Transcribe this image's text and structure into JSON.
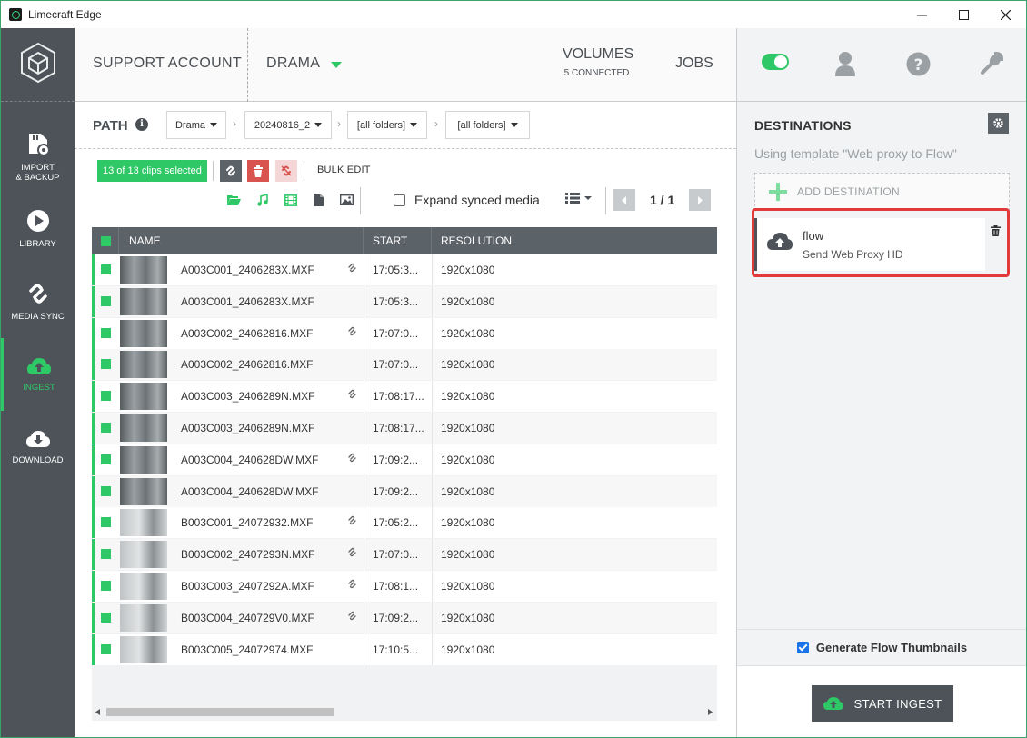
{
  "window": {
    "title": "Limecraft Edge",
    "controls": [
      "—",
      "☐",
      "✕"
    ]
  },
  "nav": {
    "items": [
      {
        "label_1": "IMPORT",
        "label_2": "& BACKUP",
        "icon": "sd-card-icon"
      },
      {
        "label": "LIBRARY",
        "icon": "play-icon"
      },
      {
        "label": "MEDIA SYNC",
        "icon": "link-icon"
      },
      {
        "label": "INGEST",
        "icon": "cloud-upload-icon",
        "active": true
      },
      {
        "label": "DOWNLOAD",
        "icon": "cloud-download-icon"
      }
    ]
  },
  "header": {
    "account": "SUPPORT ACCOUNT",
    "project": "DRAMA",
    "volumes": "VOLUMES",
    "volumes_sub": "5 CONNECTED",
    "jobs": "JOBS"
  },
  "path": {
    "label": "PATH",
    "crumbs": [
      "Drama",
      "20240816_2",
      "[all folders]",
      "[all folders]"
    ]
  },
  "toolbar": {
    "selected": "13 of 13 clips selected",
    "bulk_edit": "BULK EDIT",
    "expand_label": "Expand synced media",
    "expand_checked": false,
    "pager": "1 / 1"
  },
  "table": {
    "columns": [
      "NAME",
      "START",
      "RESOLUTION"
    ],
    "rows": [
      {
        "name": "A003C001_2406283X.MXF",
        "linked": true,
        "start": "17:05:3...",
        "res": "1920x1080"
      },
      {
        "name": "A003C001_2406283X.MXF",
        "linked": false,
        "start": "17:05:3...",
        "res": "1920x1080"
      },
      {
        "name": "A003C002_24062816.MXF",
        "linked": true,
        "start": "17:07:0...",
        "res": "1920x1080"
      },
      {
        "name": "A003C002_24062816.MXF",
        "linked": false,
        "start": "17:07:0...",
        "res": "1920x1080"
      },
      {
        "name": "A003C003_2406289N.MXF",
        "linked": true,
        "start": "17:08:17...",
        "res": "1920x1080"
      },
      {
        "name": "A003C003_2406289N.MXF",
        "linked": false,
        "start": "17:08:17...",
        "res": "1920x1080"
      },
      {
        "name": "A003C004_240628DW.MXF",
        "linked": true,
        "start": "17:09:2...",
        "res": "1920x1080"
      },
      {
        "name": "A003C004_240628DW.MXF",
        "linked": false,
        "start": "17:09:2...",
        "res": "1920x1080"
      },
      {
        "name": "B003C001_24072932.MXF",
        "linked": true,
        "start": "17:05:2...",
        "res": "1920x1080"
      },
      {
        "name": "B003C002_2407293N.MXF",
        "linked": true,
        "start": "17:07:0...",
        "res": "1920x1080"
      },
      {
        "name": "B003C003_2407292A.MXF",
        "linked": true,
        "start": "17:08:1...",
        "res": "1920x1080"
      },
      {
        "name": "B003C004_240729V0.MXF",
        "linked": true,
        "start": "17:09:2...",
        "res": "1920x1080"
      },
      {
        "name": "B003C005_24072974.MXF",
        "linked": false,
        "start": "17:10:5...",
        "res": "1920x1080"
      }
    ]
  },
  "destinations": {
    "title": "DESTINATIONS",
    "template": "Using template \"Web proxy to Flow\"",
    "add_label": "ADD DESTINATION",
    "items": [
      {
        "name": "flow",
        "sub": "Send Web Proxy HD"
      }
    ],
    "generate_thumbs": "Generate Flow Thumbnails",
    "generate_checked": true,
    "start_label": "START INGEST"
  },
  "colors": {
    "accent": "#2ec866",
    "nav_bg": "#4d5358",
    "highlight": "#e23a3a"
  }
}
